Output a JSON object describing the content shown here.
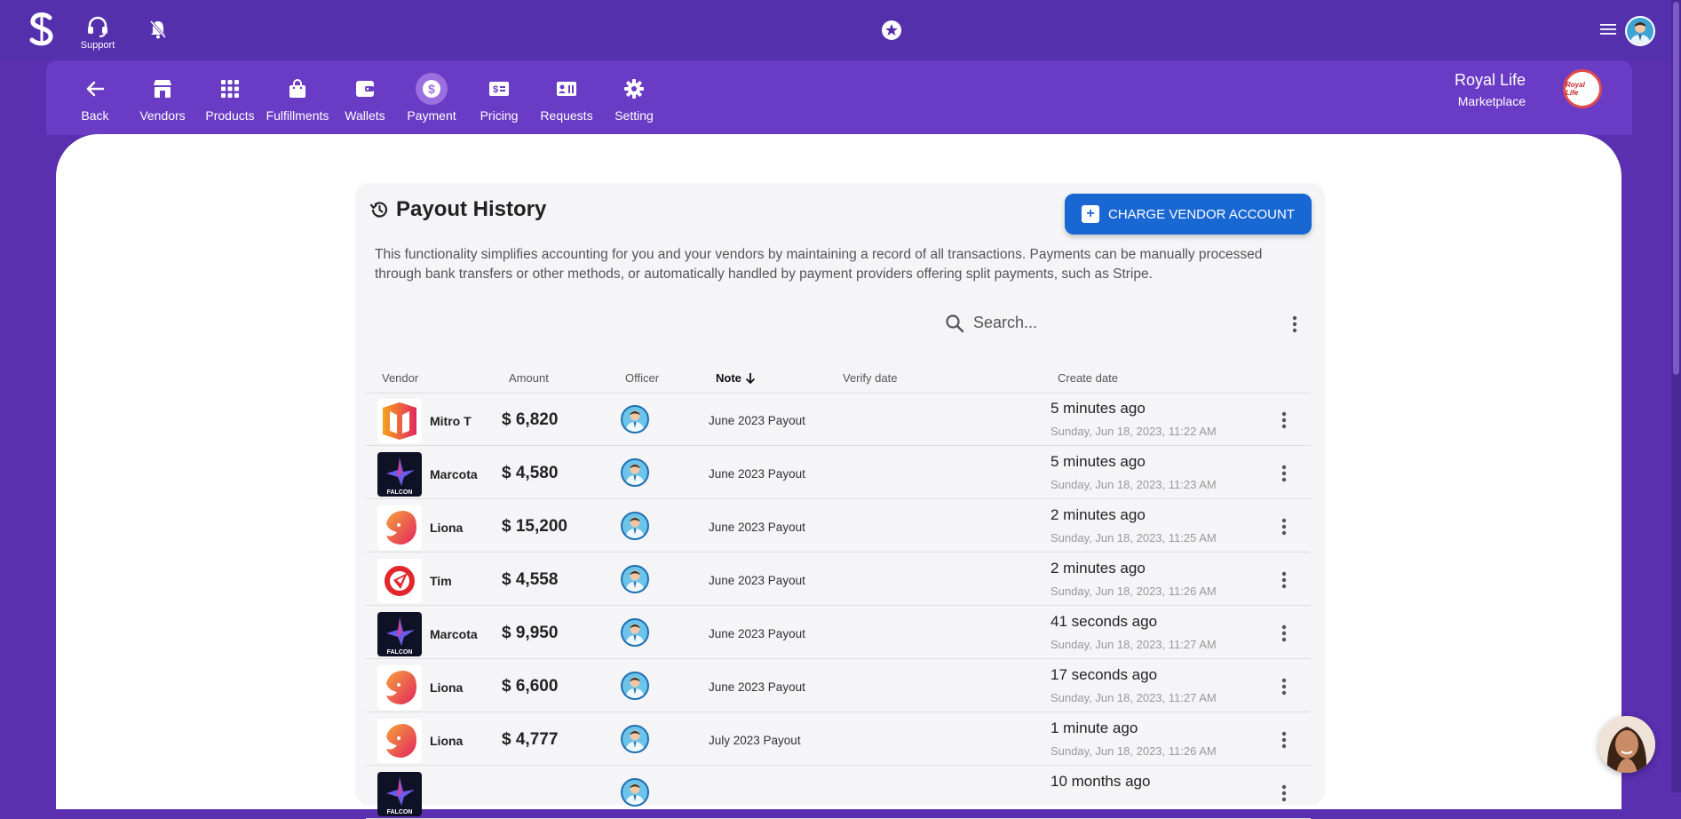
{
  "topbar": {
    "support_label": "Support"
  },
  "nav": {
    "items": [
      {
        "label": "Back",
        "icon": "arrow-left-icon"
      },
      {
        "label": "Vendors",
        "icon": "store-icon"
      },
      {
        "label": "Products",
        "icon": "grid-icon"
      },
      {
        "label": "Fulfillments",
        "icon": "bag-icon"
      },
      {
        "label": "Wallets",
        "icon": "wallet-icon"
      },
      {
        "label": "Payment",
        "icon": "dollar-icon",
        "active": true
      },
      {
        "label": "Pricing",
        "icon": "price-tag-icon"
      },
      {
        "label": "Requests",
        "icon": "contact-card-icon"
      },
      {
        "label": "Setting",
        "icon": "gear-icon"
      }
    ],
    "brand_name": "Royal Life",
    "brand_sub": "Marketplace",
    "brand_logo_text": "Royal Life"
  },
  "page": {
    "title": "Payout History",
    "charge_button": "CHARGE VENDOR ACCOUNT",
    "description": "This functionality simplifies accounting for you and your vendors by maintaining a record of all transactions. Payments can be manually processed through bank transfers or other methods, or automatically handled by payment providers offering split payments, such as Stripe.",
    "search_placeholder": "Search..."
  },
  "table": {
    "columns": {
      "vendor": "Vendor",
      "amount": "Amount",
      "officer": "Officer",
      "note": "Note",
      "verify": "Verify date",
      "create": "Create date"
    },
    "rows": [
      {
        "vendor": "Mitro T",
        "logo": "mitro",
        "amount": "$ 6,820",
        "note": "June 2023 Payout",
        "rel": "5 minutes ago",
        "abs": "Sunday, Jun 18, 2023, 11:22 AM"
      },
      {
        "vendor": "Marcota",
        "logo": "falcon",
        "amount": "$ 4,580",
        "note": "June 2023 Payout",
        "rel": "5 minutes ago",
        "abs": "Sunday, Jun 18, 2023, 11:23 AM"
      },
      {
        "vendor": "Liona",
        "logo": "lion",
        "amount": "$ 15,200",
        "note": "June 2023 Payout",
        "rel": "2 minutes ago",
        "abs": "Sunday, Jun 18, 2023, 11:25 AM"
      },
      {
        "vendor": "Tim",
        "logo": "tim",
        "amount": "$ 4,558",
        "note": "June 2023 Payout",
        "rel": "2 minutes ago",
        "abs": "Sunday, Jun 18, 2023, 11:26 AM"
      },
      {
        "vendor": "Marcota",
        "logo": "falcon",
        "amount": "$ 9,950",
        "note": "June 2023 Payout",
        "rel": "41 seconds ago",
        "abs": "Sunday, Jun 18, 2023, 11:27 AM"
      },
      {
        "vendor": "Liona",
        "logo": "lion",
        "amount": "$ 6,600",
        "note": "June 2023 Payout",
        "rel": "17 seconds ago",
        "abs": "Sunday, Jun 18, 2023, 11:27 AM"
      },
      {
        "vendor": "Liona",
        "logo": "lion",
        "amount": "$ 4,777",
        "note": "July 2023 Payout",
        "rel": "1 minute ago",
        "abs": "Sunday, Jun 18, 2023, 11:26 AM"
      },
      {
        "vendor": "",
        "logo": "falcon",
        "amount": "",
        "note": "",
        "rel": "10 months ago",
        "abs": ""
      }
    ]
  },
  "colors": {
    "topbar": "#5530ad",
    "navbar": "#6a3bc4",
    "primary_button": "#1967d2"
  }
}
